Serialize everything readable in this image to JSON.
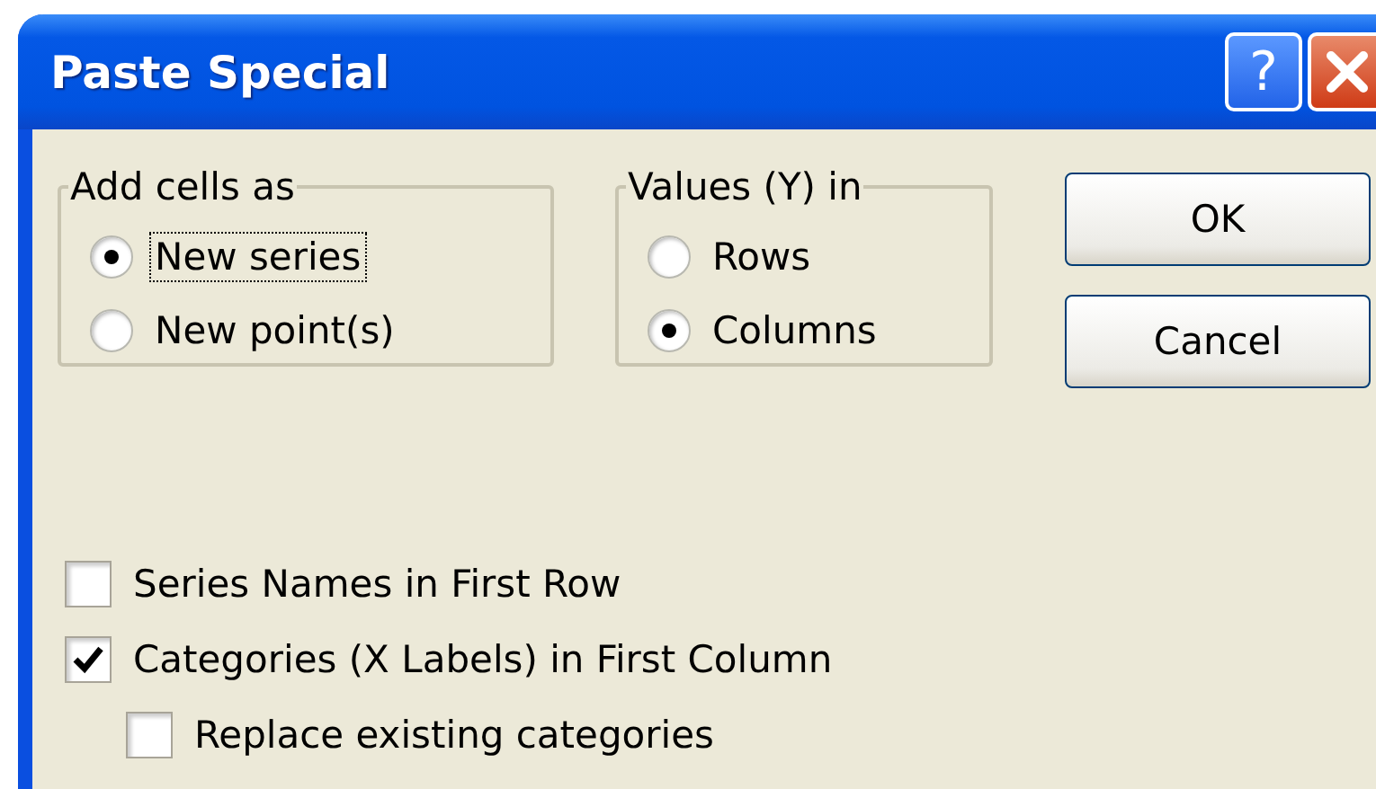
{
  "window": {
    "title": "Paste Special",
    "caption_buttons": [
      {
        "kind": "help",
        "label": "?"
      },
      {
        "kind": "close"
      }
    ]
  },
  "groups": [
    {
      "title": "Add cells as",
      "options": [
        {
          "label": "New series",
          "selected": true,
          "focused": true
        },
        {
          "label": "New point(s)",
          "selected": false,
          "focused": false
        }
      ]
    },
    {
      "title": "Values (Y) in",
      "options": [
        {
          "label": "Rows",
          "selected": false,
          "focused": false
        },
        {
          "label": "Columns",
          "selected": true,
          "focused": false
        }
      ]
    }
  ],
  "buttons": [
    "OK",
    "Cancel"
  ],
  "checkboxes": [
    {
      "label": "Series Names in First Row",
      "checked": false
    },
    {
      "label": "Categories (X Labels) in First Column",
      "checked": true,
      "children": [
        {
          "label": "Replace existing categories",
          "checked": false
        }
      ]
    }
  ]
}
